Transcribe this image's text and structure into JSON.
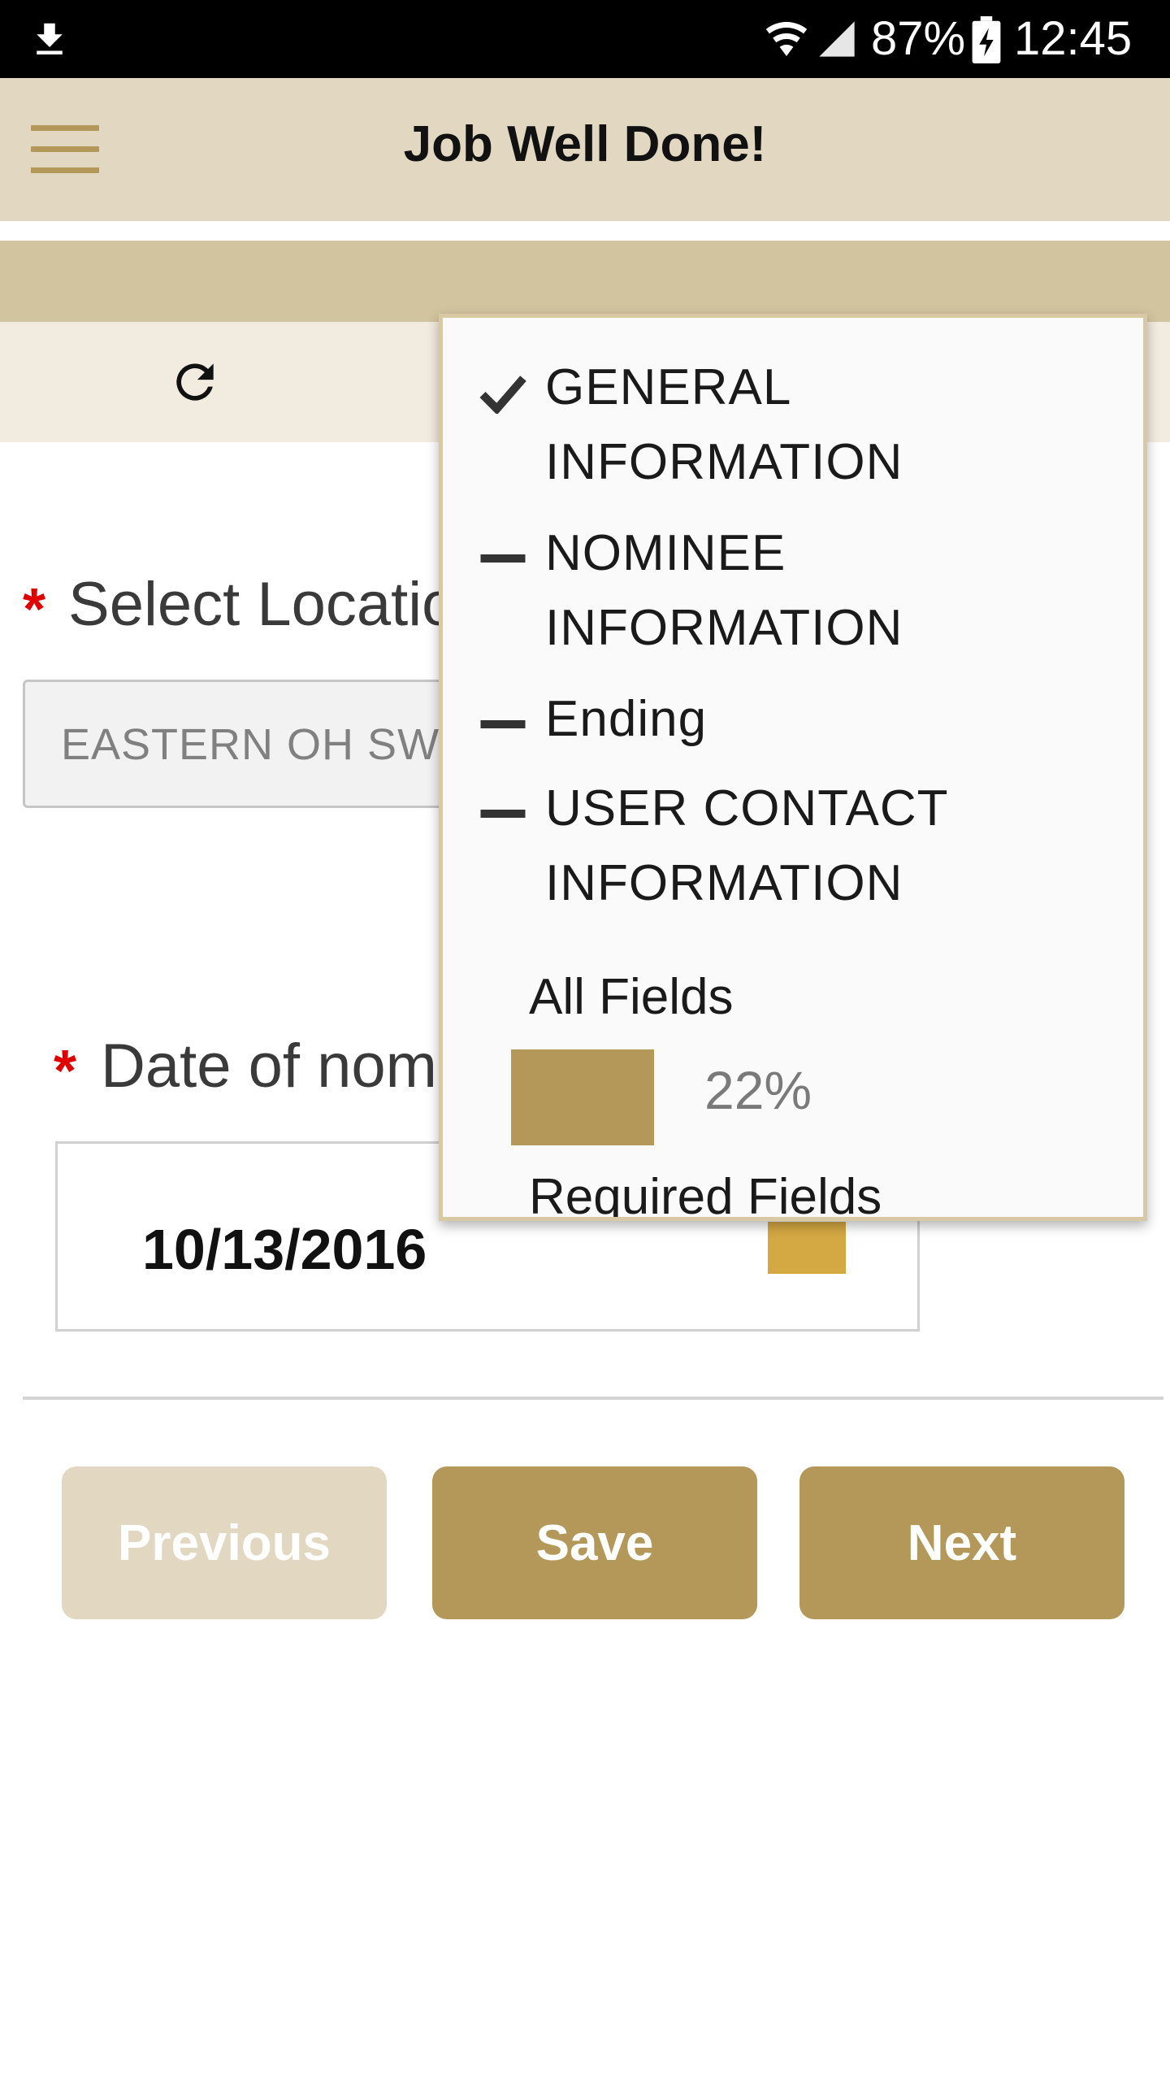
{
  "status_bar": {
    "battery_percent": "87%",
    "time": "12:45"
  },
  "app_bar": {
    "title": "Job Well Done!"
  },
  "form": {
    "location": {
      "required_mark": "*",
      "label": "Select Location",
      "value": "EASTERN OH SWIFT"
    },
    "date": {
      "required_mark": "*",
      "label": "Date of nomination",
      "value": "10/13/2016"
    }
  },
  "buttons": {
    "previous": "Previous",
    "save": "Save",
    "next": "Next"
  },
  "sections_dropdown": {
    "items": [
      {
        "label": "GENERAL INFORMATION",
        "status": "complete"
      },
      {
        "label": "NOMINEE INFORMATION",
        "status": "incomplete"
      },
      {
        "label": "Ending",
        "status": "incomplete"
      },
      {
        "label": "USER CONTACT INFORMATION",
        "status": "incomplete"
      }
    ],
    "all_fields_label": "All Fields",
    "all_fields_percent": "22%",
    "required_fields_label": "Required Fields"
  },
  "colors": {
    "accent": "#b4985a",
    "app_bar": "#e2d8c1",
    "required": "#e00000"
  }
}
